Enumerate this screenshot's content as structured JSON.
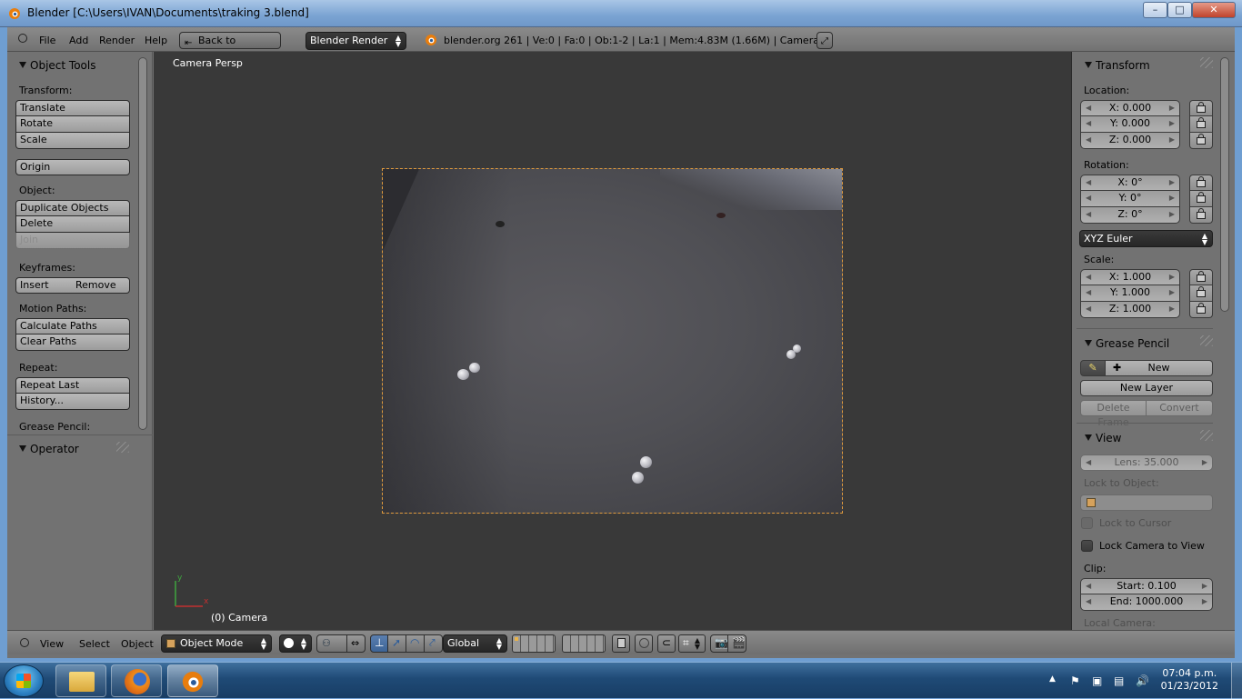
{
  "window": {
    "title": "Blender [C:\\Users\\IVAN\\Documents\\traking 3.blend]",
    "minimize": "–",
    "maximize": "□",
    "close": "✕"
  },
  "info_header": {
    "menus": [
      "File",
      "Add",
      "Render",
      "Help"
    ],
    "back_button": "Back to Previous",
    "render_engine": "Blender Render",
    "stats": "blender.org 261 | Ve:0 | Fa:0 | Ob:1-2 | La:1 | Mem:4.83M (1.66M) | Camera"
  },
  "toolshelf": {
    "object_tools_title": "Object Tools",
    "transform_label": "Transform:",
    "translate": "Translate",
    "rotate": "Rotate",
    "scale": "Scale",
    "origin": "Origin",
    "object_label": "Object:",
    "duplicate_objects": "Duplicate Objects",
    "delete": "Delete",
    "join": "Join",
    "keyframes_label": "Keyframes:",
    "insert": "Insert",
    "remove": "Remove",
    "motion_paths_label": "Motion Paths:",
    "calculate_paths": "Calculate Paths",
    "clear_paths": "Clear Paths",
    "repeat_label": "Repeat:",
    "repeat_last": "Repeat Last",
    "history": "History...",
    "grease_pencil_label": "Grease Pencil:",
    "operator_title": "Operator"
  },
  "viewport": {
    "view_label": "Camera Persp",
    "object_name": "(0) Camera",
    "axis_x": "x",
    "axis_y": "y"
  },
  "properties": {
    "transform_title": "Transform",
    "location_label": "Location:",
    "loc_x": "X: 0.000",
    "loc_y": "Y: 0.000",
    "loc_z": "Z: 0.000",
    "rotation_label": "Rotation:",
    "rot_x": "X: 0°",
    "rot_y": "Y: 0°",
    "rot_z": "Z: 0°",
    "rotation_mode": "XYZ Euler",
    "scale_label": "Scale:",
    "scale_x": "X: 1.000",
    "scale_y": "Y: 1.000",
    "scale_z": "Z: 1.000",
    "grease_pencil_title": "Grease Pencil",
    "gp_new": "New",
    "gp_new_layer": "New Layer",
    "gp_delete_frame": "Delete Frame",
    "gp_convert": "Convert",
    "view_title": "View",
    "lens": "Lens: 35.000",
    "lock_to_object_label": "Lock to Object:",
    "lock_to_cursor": "Lock to Cursor",
    "lock_camera_to_view": "Lock Camera to View",
    "clip_label": "Clip:",
    "clip_start": "Start: 0.100",
    "clip_end": "End: 1000.000",
    "local_camera_label": "Local Camera:"
  },
  "view3d_header": {
    "menus": [
      "View",
      "Select",
      "Object"
    ],
    "mode": "Object Mode",
    "orientation": "Global"
  },
  "taskbar": {
    "time": "07:04 p.m.",
    "date": "01/23/2012"
  },
  "colors": {
    "camera_border": "#e09a3c",
    "viewport_bg": "#393939",
    "panel_bg": "#727272"
  }
}
